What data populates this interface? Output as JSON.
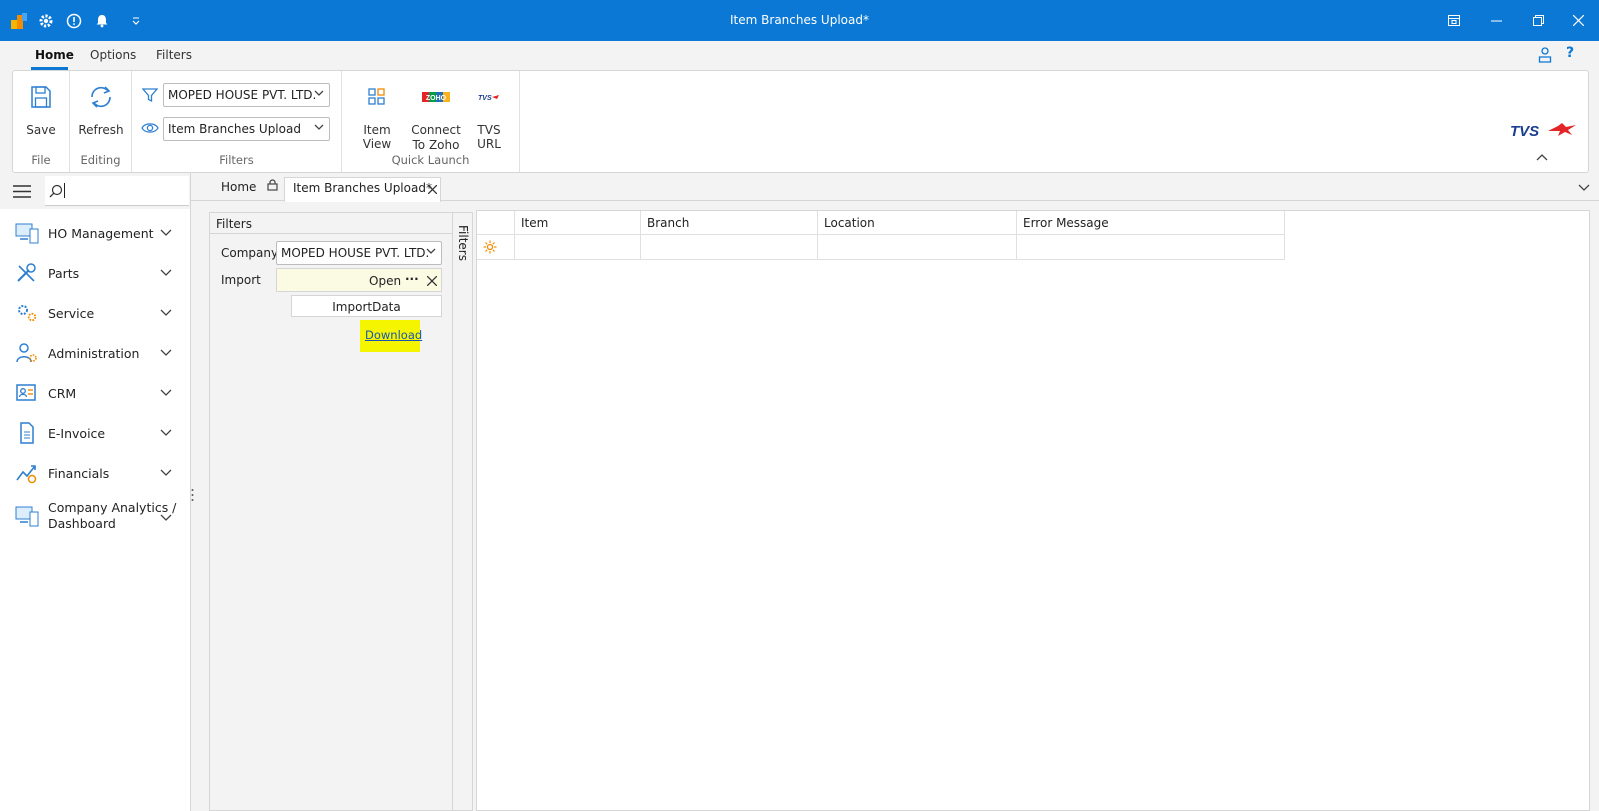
{
  "window": {
    "title": "Item Branches Upload*"
  },
  "ribbon": {
    "tabs": [
      "Home",
      "Options",
      "Filters"
    ],
    "save_label": "Save",
    "refresh_label": "Refresh",
    "file_group": "File",
    "editing_group": "Editing",
    "filters_group": "Filters",
    "company_combo_value": "MOPED HOUSE PVT. LTD.",
    "view_combo_value": "Item Branches Upload",
    "item_view_label": "Item View",
    "connect_zoho_label_1": "Connect",
    "connect_zoho_label_2": "To Zoho",
    "tvs_url_label": "TVS URL",
    "quick_launch_group": "Quick Launch",
    "brand_logo_text": "TVS",
    "zoho_logo_text": "ZOHO",
    "tvs_small_logo_text": "TVS"
  },
  "sidebar": {
    "search_placeholder": "",
    "items": [
      {
        "label": "HO Management",
        "icon": "monitor-icon"
      },
      {
        "label": "Parts",
        "icon": "tools-icon"
      },
      {
        "label": "Service",
        "icon": "gears-icon"
      },
      {
        "label": "Administration",
        "icon": "user-settings-icon"
      },
      {
        "label": "CRM",
        "icon": "contact-card-icon"
      },
      {
        "label": "E-Invoice",
        "icon": "document-icon"
      },
      {
        "label": "Financials",
        "icon": "chart-coins-icon"
      },
      {
        "label": "Company Analytics / Dashboard",
        "label_line1": "Company Analytics /",
        "label_line2": "Dashboard",
        "icon": "monitor-icon"
      }
    ]
  },
  "doc_tabs": {
    "home": "Home",
    "active": "Item Branches Upload*"
  },
  "filters_panel": {
    "title": "Filters",
    "company_label": "Company",
    "company_value": "MOPED HOUSE PVT. LTD.",
    "import_label": "Import",
    "import_value": "Open",
    "import_data_button": "ImportData",
    "download_link": "Download",
    "side_strip_label": "Filters"
  },
  "grid": {
    "columns": [
      "Item",
      "Branch",
      "Location",
      "Error Message"
    ],
    "rows": [
      [
        "",
        "",
        "",
        ""
      ]
    ]
  },
  "colors": {
    "accent": "#0a78d4",
    "highlight": "#f5f500",
    "import_field_bg": "#fbfbe4"
  }
}
